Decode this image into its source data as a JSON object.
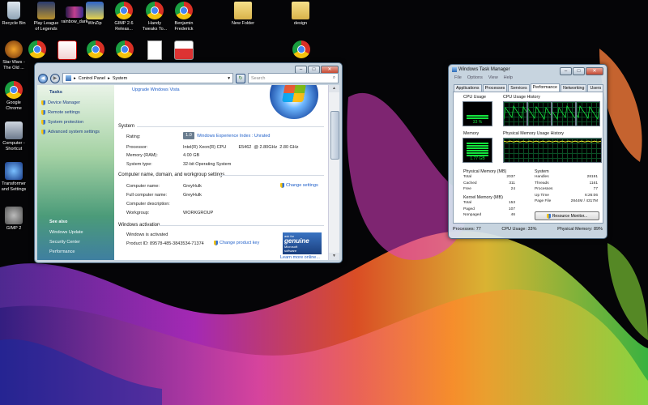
{
  "desktop": {
    "icons": [
      {
        "label": "Recycle Bin",
        "icon": "recycle-bin-icon"
      },
      {
        "label": "Play League\nof Legends",
        "icon": "league-icon"
      },
      {
        "label": "rainbow_dark",
        "icon": "image-file-icon"
      },
      {
        "label": "WinZip",
        "icon": "winzip-icon"
      },
      {
        "label": "GIMP 2.6\nReleas...",
        "icon": "chrome-icon"
      },
      {
        "label": "Handy\nTweaks To...",
        "icon": "chrome-icon"
      },
      {
        "label": "Benjamin\nFrederick",
        "icon": "chrome-icon"
      },
      {
        "label": "New Folder",
        "icon": "folder-icon"
      },
      {
        "label": "design",
        "icon": "folder-icon"
      },
      {
        "label": "Star Wars -\nThe Old ...",
        "icon": "game-icon"
      },
      {
        "label": "",
        "icon": "chrome-icon"
      },
      {
        "label": "",
        "icon": "document-icon"
      },
      {
        "label": "",
        "icon": "chrome-icon"
      },
      {
        "label": "",
        "icon": "chrome-icon"
      },
      {
        "label": "",
        "icon": "text-file-icon"
      },
      {
        "label": "",
        "icon": "calendar-icon"
      },
      {
        "label": "",
        "icon": "chrome-icon"
      },
      {
        "label": "Google\nChrome",
        "icon": "chrome-icon"
      },
      {
        "label": "Computer -\nShortcut",
        "icon": "computer-icon"
      },
      {
        "label": "Transformer\nand Settings",
        "icon": "network-icon"
      },
      {
        "label": "GIMP 2",
        "icon": "gimp-icon"
      }
    ]
  },
  "control_panel": {
    "breadcrumb": [
      "Control Panel",
      "System"
    ],
    "search_placeholder": "Search",
    "tasks_header": "Tasks",
    "tasks": [
      "Device Manager",
      "Remote settings",
      "System protection",
      "Advanced system settings"
    ],
    "see_also_header": "See also",
    "see_also": [
      "Windows Update",
      "Security Center",
      "Performance"
    ],
    "upgrade_link": "Upgrade Windows Vista",
    "system_header": "System",
    "rating_label": "Rating:",
    "rating_badge": "1.0",
    "rating_link": "Windows Experience Index : Unrated",
    "processor_label": "Processor:",
    "processor_value": "Intel(R) Xeon(R) CPU          E5462  @ 2.80GHz  2.80 GHz",
    "memory_label": "Memory (RAM):",
    "memory_value": "4.00 GB",
    "systype_label": "System type:",
    "systype_value": "32-bit Operating System",
    "computer_header": "Computer name, domain, and workgroup settings",
    "change_settings": "Change settings",
    "compname_label": "Computer name:",
    "compname_value": "GreyHulk",
    "fullname_label": "Full computer name:",
    "fullname_value": "GreyHulk",
    "desc_label": "Computer description:",
    "workgroup_label": "Workgroup:",
    "workgroup_value": "WORKGROUP",
    "activation_header": "Windows activation",
    "activated_text": "Windows is activated",
    "productid_label": "Product ID: 89578-485-3843534-71374",
    "change_key": "Change product key",
    "genuine_small": "ask for",
    "genuine_big": "genuine",
    "genuine_brand": "Microsoft",
    "genuine_sw": "software",
    "learn_more": "Learn more online..."
  },
  "task_manager": {
    "title": "Windows Task Manager",
    "menus": [
      "File",
      "Options",
      "View",
      "Help"
    ],
    "tabs": [
      "Applications",
      "Processes",
      "Services",
      "Performance",
      "Networking",
      "Users"
    ],
    "active_tab": "Performance",
    "cpu_usage_label": "CPU Usage",
    "cpu_history_label": "CPU Usage History",
    "cpu_percent_text": "33 %",
    "cpu_fraction": 0.33,
    "memory_label": "Memory",
    "mem_history_label": "Physical Memory Usage History",
    "mem_text": "1.77 GB",
    "mem_fraction": 0.89,
    "physmem_header": "Physical Memory (MB)",
    "physmem": [
      {
        "k": "Total",
        "v": "2037"
      },
      {
        "k": "Cached",
        "v": "311"
      },
      {
        "k": "Free",
        "v": "24"
      }
    ],
    "system_header": "System",
    "system": [
      {
        "k": "Handles",
        "v": "28191"
      },
      {
        "k": "Threads",
        "v": "1161"
      },
      {
        "k": "Processes",
        "v": "77"
      },
      {
        "k": "Up Time",
        "v": "6:26:06"
      },
      {
        "k": "Page File",
        "v": "2844M / 4317M"
      }
    ],
    "kernel_header": "Kernel Memory (MB)",
    "kernel": [
      {
        "k": "Total",
        "v": "153"
      },
      {
        "k": "Paged",
        "v": "107"
      },
      {
        "k": "Nonpaged",
        "v": "46"
      }
    ],
    "resmon_label": "Resource Monitor...",
    "status_processes": "Processes: 77",
    "status_cpu": "CPU Usage: 33%",
    "status_mem": "Physical Memory: 89%"
  },
  "colors": {
    "accent_link": "#1f5fc9",
    "graph_green": "#14e43d",
    "window_frame": "#d6e4f0"
  }
}
